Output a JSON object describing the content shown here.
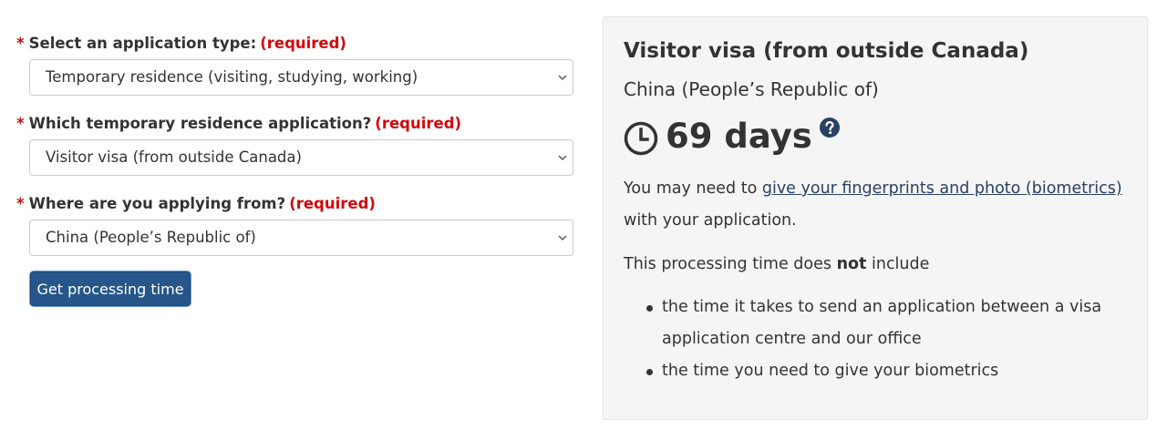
{
  "form": {
    "required_text": "(required)",
    "required_marker": "*",
    "fields": [
      {
        "label": "Select an application type:",
        "value": "Temporary residence (visiting, studying, working)"
      },
      {
        "label": "Which temporary residence application?",
        "value": "Visitor visa (from outside Canada)"
      },
      {
        "label": "Where are you applying from?",
        "value": "China (People’s Republic of)"
      }
    ],
    "submit_label": "Get processing time"
  },
  "result": {
    "title": "Visitor visa (from outside Canada)",
    "country": "China (People’s Republic of)",
    "processing_time": "69 days",
    "biometrics_before": "You may need to ",
    "biometrics_link": "give your fingerprints and photo (biometrics)",
    "biometrics_after": " with your application.",
    "exclusion_before": "This processing time does ",
    "exclusion_bold": "not",
    "exclusion_after": " include",
    "bullets": [
      "the time it takes to send an application between a visa application centre and our office",
      "the time you need to give your biometrics"
    ]
  },
  "icons": {
    "clock": "clock-icon",
    "help": "question-circle-icon",
    "dropdown": "chevron-down-icon"
  },
  "colors": {
    "required": "#d3080c",
    "button": "#26568a",
    "link": "#284162",
    "panel_bg": "#f5f5f5"
  }
}
